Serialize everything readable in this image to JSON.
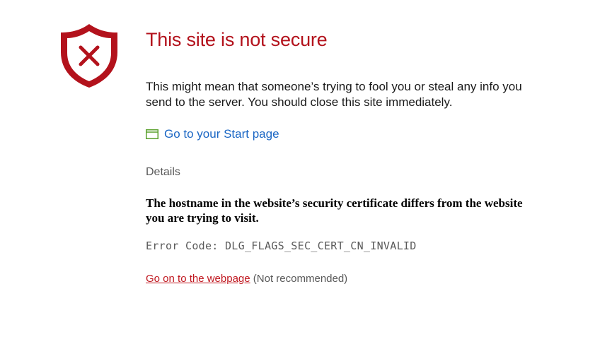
{
  "error": {
    "title": "This site is not secure",
    "description": "This might mean that someone’s trying to fool you or steal any info you send to the server. You should close this site immediately.",
    "start_page_label": "Go to your Start page",
    "details_label": "Details",
    "certificate_message": "The hostname in the website’s security certificate differs from the website you are trying to visit.",
    "error_code_text": "Error Code: DLG_FLAGS_SEC_CERT_CN_INVALID",
    "go_on_label": "Go on to the webpage",
    "not_recommended_label": "(Not recommended)"
  },
  "icons": {
    "shield": "shield-error-icon",
    "start_page": "browser-window-icon"
  },
  "colors": {
    "danger": "#b3121c",
    "link": "#1a66c4",
    "start_icon": "#5aa02c",
    "muted": "#595959"
  }
}
